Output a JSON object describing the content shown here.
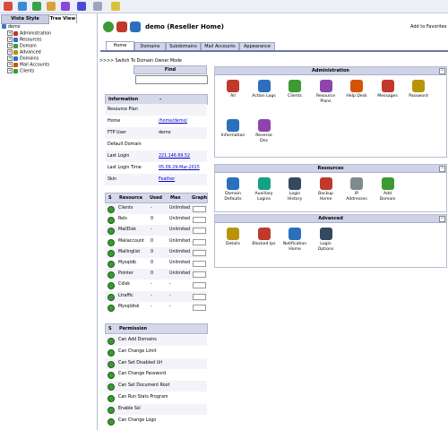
{
  "left_tabs": [
    "Vista Style",
    "Tree View"
  ],
  "tree": {
    "root": "demo",
    "items": [
      "Administration",
      "Resources",
      "Domain",
      "Advanced",
      "Domains",
      "Mail Accounts",
      "Clients"
    ]
  },
  "header": {
    "user": "demo",
    "role": "(Reseller Home)",
    "favorites": "Add to Favorites"
  },
  "tabs": [
    "Home",
    "Domains",
    "Subdomains",
    "Mail Accounts",
    "Appearance"
  ],
  "switch_link": ">>>> Switch To Domain Owner Mode",
  "find": {
    "label": "Find",
    "value": ""
  },
  "information": {
    "title": "Information",
    "dash": "-",
    "rows": [
      {
        "label": "Resource Plan",
        "value": ""
      },
      {
        "label": "Home",
        "value": "/home/demo/"
      },
      {
        "label": "FTP User",
        "value": "demo"
      },
      {
        "label": "Default Domain",
        "value": ""
      },
      {
        "label": "Last Login",
        "value": "221.146.69.52"
      },
      {
        "label": "Last Login Time",
        "value": "05.09.29-Mar-2015"
      },
      {
        "label": "Skin",
        "value": "Feather"
      }
    ]
  },
  "resources": {
    "headers": [
      "S",
      "Resource",
      "Used",
      "Max",
      "Graph"
    ],
    "rows": [
      {
        "name": "Clients",
        "used": "-",
        "max": "Unlimited"
      },
      {
        "name": "Rels",
        "used": "0",
        "max": "Unlimited"
      },
      {
        "name": "MailDisk",
        "used": "-",
        "max": "Unlimited"
      },
      {
        "name": "Mailaccount",
        "used": "0",
        "max": "Unlimited"
      },
      {
        "name": "Mailinglist",
        "used": "0",
        "max": "Unlimited"
      },
      {
        "name": "Mysqldb",
        "used": "0",
        "max": "Unlimited"
      },
      {
        "name": "Pointer",
        "used": "0",
        "max": "Unlimited"
      },
      {
        "name": "Cdisk",
        "used": "-",
        "max": "-"
      },
      {
        "name": "Ltraffic",
        "used": "-",
        "max": "-"
      },
      {
        "name": "Mysqldisk",
        "used": "-",
        "max": "-"
      }
    ]
  },
  "permission": {
    "headers": [
      "S",
      "Permission"
    ],
    "rows": [
      "Can Add Domains",
      "Can Change Limit",
      "Can Set Disabled Url",
      "Can Change Password",
      "Can Set Document Root",
      "Can Run Stats Program",
      "Enable Ssl",
      "Can Change Logo"
    ]
  },
  "panels": [
    {
      "title": "Administration",
      "items": [
        {
          "label": "All",
          "color": "#c0392b"
        },
        {
          "label": "Action Logs",
          "color": "#2c6fbf"
        },
        {
          "label": "Clients",
          "color": "#3b9a32"
        },
        {
          "label": "Resource Plans",
          "color": "#8e44ad"
        },
        {
          "label": "Help Desk",
          "color": "#d35400"
        },
        {
          "label": "Messages",
          "color": "#c0392b"
        },
        {
          "label": "Password",
          "color": "#b7950b"
        },
        {
          "label": "Information",
          "color": "#2c6fbf"
        },
        {
          "label": "Reverse Dns",
          "color": "#8e44ad"
        }
      ]
    },
    {
      "title": "Resources",
      "items": [
        {
          "label": "Domain Defaults",
          "color": "#2c6fbf"
        },
        {
          "label": "Auxiliary Logins",
          "color": "#16a085"
        },
        {
          "label": "Login History",
          "color": "#34495e"
        },
        {
          "label": "Backup Home",
          "color": "#c0392b"
        },
        {
          "label": "IP Addresses",
          "color": "#7f8c8d"
        },
        {
          "label": "Add Domain",
          "color": "#3b9a32"
        }
      ]
    },
    {
      "title": "Advanced",
      "items": [
        {
          "label": "Details",
          "color": "#b7950b"
        },
        {
          "label": "Blocked Ips",
          "color": "#c0392b"
        },
        {
          "label": "Notification Home",
          "color": "#2c6fbf"
        },
        {
          "label": "Login Options",
          "color": "#34495e"
        }
      ]
    }
  ]
}
